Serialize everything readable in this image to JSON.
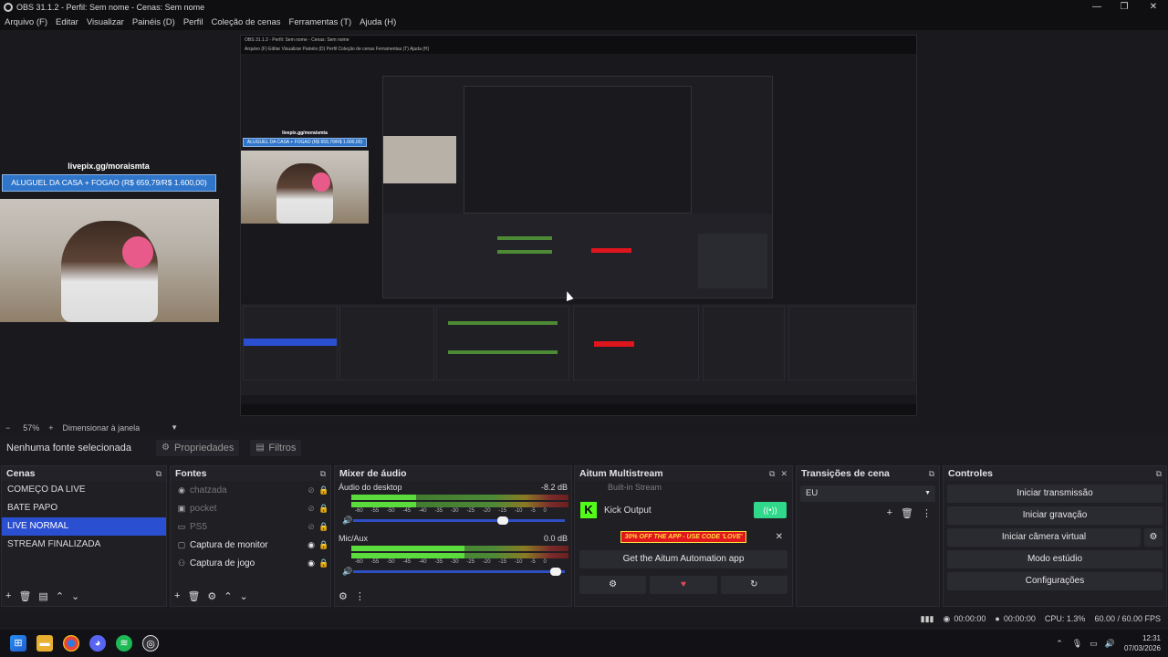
{
  "window": {
    "title": "OBS 31.1.2 - Perfil: Sem nome - Cenas: Sem nome",
    "minimize": "—",
    "maximize": "❐",
    "close": "✕"
  },
  "menu": [
    "Arquivo (F)",
    "Editar",
    "Visualizar",
    "Painéis (D)",
    "Perfil",
    "Coleção de cenas",
    "Ferramentas (T)",
    "Ajuda (H)"
  ],
  "preview": {
    "overlay_url": "livepix.gg/moraismta",
    "overlay_bar": "ALUGUEL DA CASA + FOGAO (R$ 659,79/R$ 1.600,00)",
    "nested_title": "OBS 31.1.2 - Perfil: Sem nome - Cenas: Sem nome",
    "nested_menu": "Arquivo (F)   Editar   Visualizar   Painéis (D)   Perfil   Coleção de cenas   Ferramentas (T)   Ajuda (H)"
  },
  "zoom": {
    "minus": "−",
    "value": "57%",
    "plus": "+",
    "mode": "Dimensionar à janela"
  },
  "context": {
    "no_source": "Nenhuma fonte selecionada",
    "properties": "Propriedades",
    "filters": "Filtros"
  },
  "scenes": {
    "title": "Cenas",
    "items": [
      "COMEÇO DA LIVE",
      "BATE PAPO",
      "LIVE NORMAL",
      "STREAM FINALIZADA"
    ],
    "selected_index": 2
  },
  "sources": {
    "title": "Fontes",
    "items": [
      {
        "name": "chatzada",
        "icon": "browser-icon",
        "visible": false
      },
      {
        "name": "pocket",
        "icon": "image-icon",
        "visible": false
      },
      {
        "name": "PS5",
        "icon": "camera-icon",
        "visible": false
      },
      {
        "name": "Captura de monitor",
        "icon": "monitor-icon",
        "visible": true
      },
      {
        "name": "Captura de jogo",
        "icon": "gamepad-icon",
        "visible": true
      }
    ]
  },
  "mixer": {
    "title": "Mixer de áudio",
    "channels": [
      {
        "name": "Áudio do desktop",
        "db": "-8.2 dB",
        "level": 0.3,
        "volume": 0.72
      },
      {
        "name": "Mic/Aux",
        "db": "0.0 dB",
        "level": 0.52,
        "volume": 0.98
      }
    ],
    "ticks": [
      "-60",
      "-55",
      "-50",
      "-45",
      "-40",
      "-35",
      "-30",
      "-25",
      "-20",
      "-15",
      "-10",
      "-5",
      "0"
    ]
  },
  "aitum": {
    "title": "Aitum Multistream",
    "partial_item": "Built-in Stream",
    "kick_label": "Kick Output",
    "promo": "30% OFF THE APP - USE CODE 'LOVE'",
    "cta": "Get the Aitum Automation app"
  },
  "transitions": {
    "title": "Transições de cena",
    "selected": "EU"
  },
  "controls": {
    "title": "Controles",
    "buttons": [
      "Iniciar transmissão",
      "Iniciar gravação",
      "Iniciar câmera virtual",
      "Modo estúdio",
      "Configurações"
    ]
  },
  "status": {
    "stream_time": "00:00:00",
    "rec_time": "00:00:00",
    "cpu": "CPU: 1.3%",
    "fps": "60.00 / 60.00 FPS"
  },
  "taskbar": {
    "time": "12:31",
    "date": "07/03/2026"
  },
  "colors": {
    "selected": "#2b4fd1",
    "kick": "#53fc18",
    "toggle": "#2fd88a",
    "promo": "#e0161e",
    "overlay_bar": "#2f75c9"
  }
}
